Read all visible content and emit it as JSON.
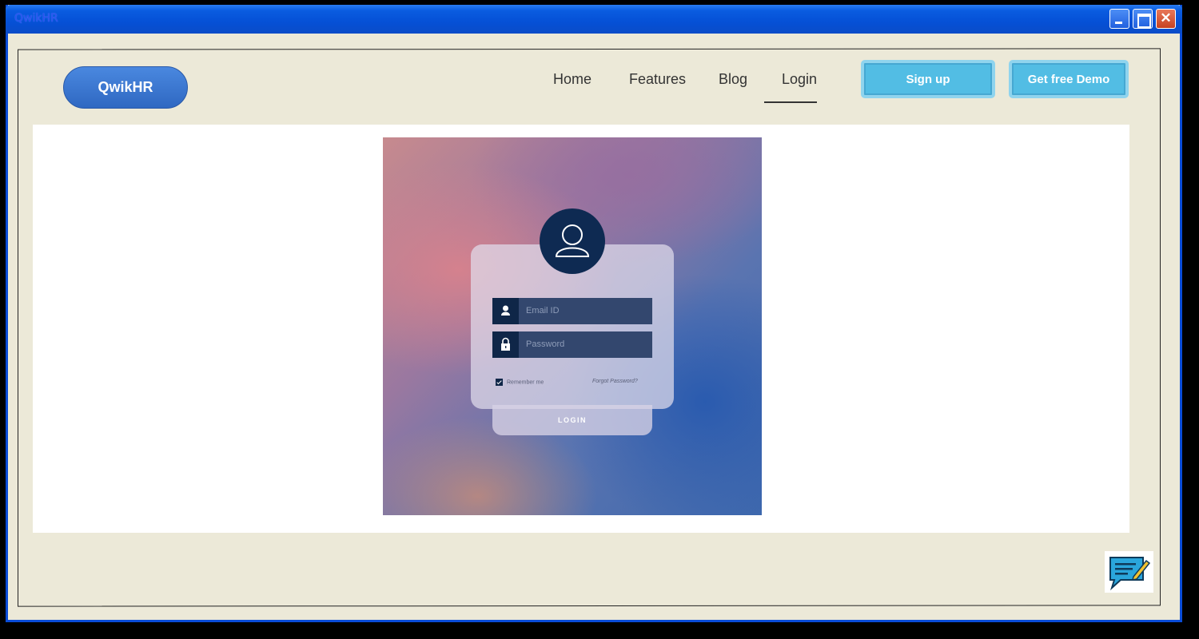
{
  "window": {
    "title": "QwikHR"
  },
  "header": {
    "logo": "QwikHR",
    "nav": [
      {
        "label": "Home"
      },
      {
        "label": "Features"
      },
      {
        "label": "Blog"
      },
      {
        "label": "Login",
        "active": true
      }
    ],
    "signup_label": "Sign up",
    "demo_label": "Get free Demo"
  },
  "hero_image": {
    "email_placeholder": "Email ID",
    "password_placeholder": "Password",
    "remember_label": "Remember me",
    "forgot_label": "Forgot Password?",
    "login_label": "LOGIN"
  },
  "colors": {
    "titlebar": "#0550d6",
    "window_bg": "#ece9d8",
    "logo_bg": "#3a78d2",
    "cta_bg": "#52bde4",
    "avatar_bg": "#0e2a52"
  },
  "icons": {
    "chat": "chat-edit-icon",
    "user": "user-icon",
    "lock": "lock-icon"
  }
}
